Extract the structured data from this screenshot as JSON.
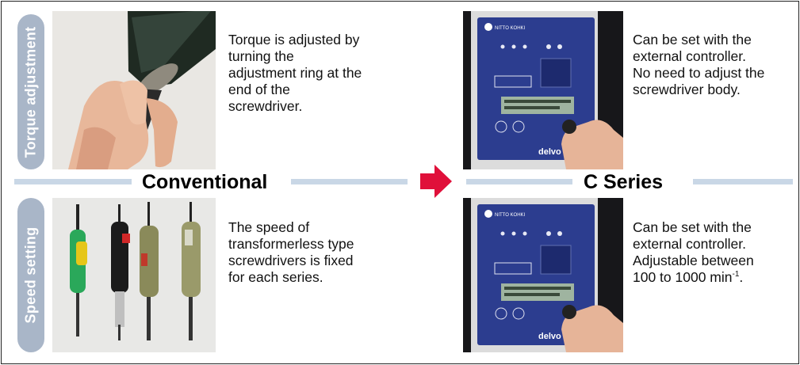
{
  "side_tabs": {
    "torque": "Torque adjustment",
    "speed": "Speed setting"
  },
  "headers": {
    "conventional": "Conventional",
    "c_series": "C Series"
  },
  "descriptions": {
    "conventional_torque": [
      "Torque is adjusted by",
      "turning the",
      "adjustment ring at the",
      "end of the",
      "screwdriver."
    ],
    "c_series_torque": [
      "Can be set with the",
      "external controller.",
      "No need to adjust the",
      "screwdriver body."
    ],
    "conventional_speed": [
      "The speed of",
      "transformerless type",
      "screwdrivers is fixed",
      "for each series."
    ],
    "c_series_speed": [
      "Can be set with the",
      "external controller.",
      "Adjustable between"
    ],
    "c_series_speed_last": "100 to 1000 min",
    "c_series_speed_sup": "-1",
    "c_series_speed_end": "."
  },
  "controller_brand": "delvo",
  "controller_logo_text": "NITTO KOHKI",
  "colors": {
    "side_tab": "#a9b6c8",
    "band": "#c9d7e6",
    "arrow": "#e0103a",
    "controller_panel": "#2c3d8f"
  }
}
